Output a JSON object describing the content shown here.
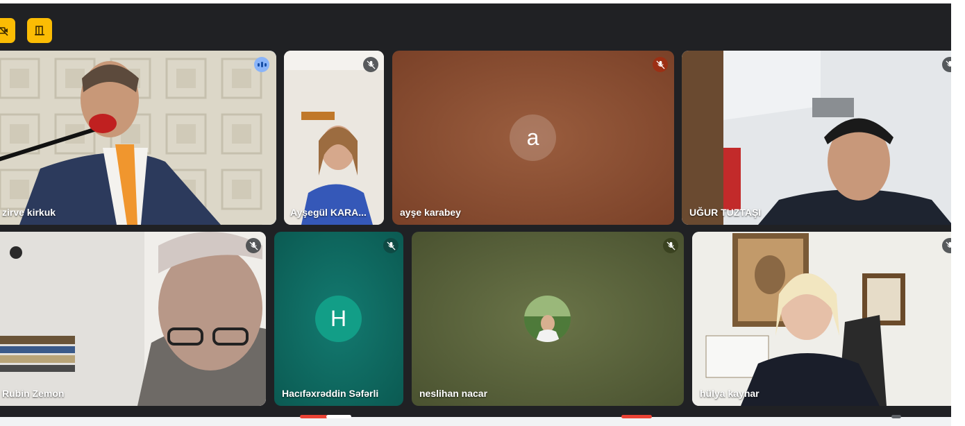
{
  "meeting": {
    "tiles": [
      {
        "name": "zirve kirkuk",
        "state": "speaking",
        "avatar_letter": ""
      },
      {
        "name": "Ayşegül KARA...",
        "state": "muted",
        "avatar_letter": ""
      },
      {
        "name": "ayşe karabey",
        "state": "muted",
        "avatar_letter": "a"
      },
      {
        "name": "UĞUR TUZTAŞI",
        "state": "muted",
        "avatar_letter": ""
      },
      {
        "name": "Rubin Zemon",
        "state": "muted",
        "avatar_letter": ""
      },
      {
        "name": "Hacıfəxrəddin Səfərli",
        "state": "muted",
        "avatar_letter": "H"
      },
      {
        "name": "neslihan nacar",
        "state": "muted",
        "avatar_letter": ""
      },
      {
        "name": "hülya kaynar",
        "state": "muted",
        "avatar_letter": ""
      }
    ]
  },
  "toolbar": {
    "icons": [
      "no-camera-icon",
      "exit-door-icon"
    ]
  },
  "colors": {
    "background": "#202124",
    "accent_pill": "#fbbc04",
    "speaking_indicator": "#8ab4f8",
    "tile_brown": "#8b4f33",
    "tile_teal": "#0f6b63",
    "tile_olive": "#55603a",
    "avatar_teal": "#129e87"
  }
}
